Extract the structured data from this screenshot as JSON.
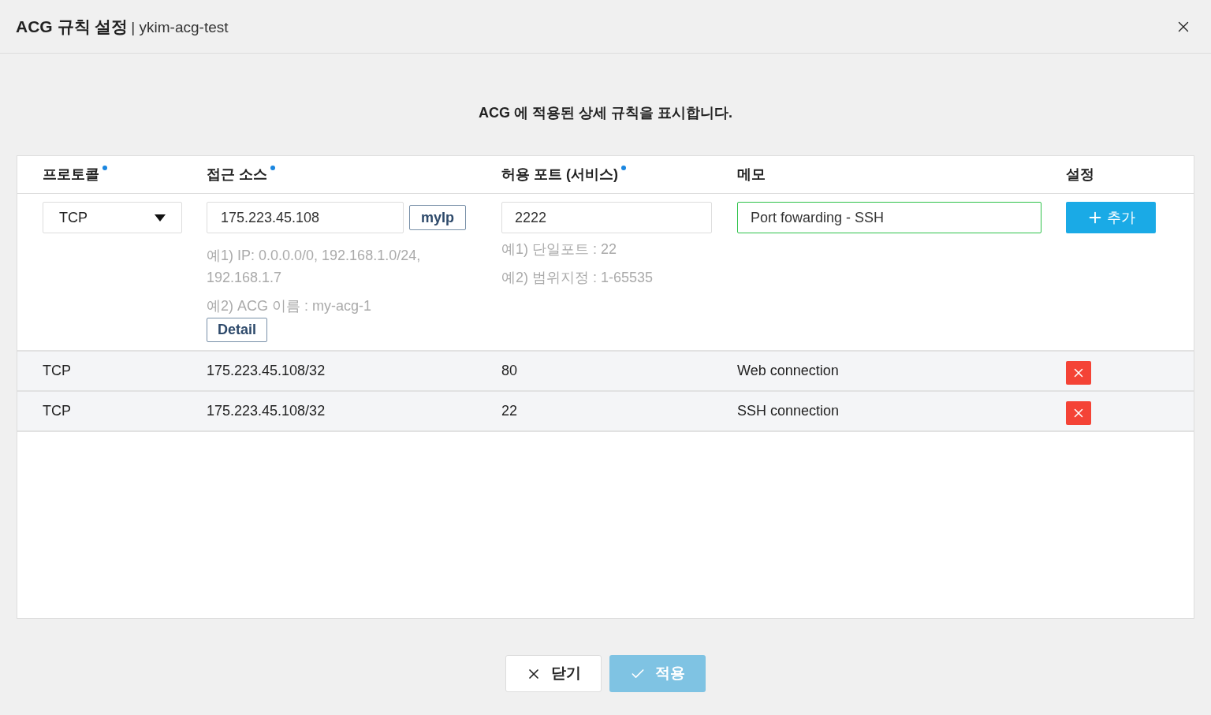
{
  "dialog": {
    "title": "ACG 규칙 설정",
    "separator": "|",
    "subtitle": "ykim-acg-test"
  },
  "description": "ACG 에 적용된 상세 규칙을 표시합니다.",
  "table": {
    "columns": [
      {
        "label": "프로토콜",
        "required": true
      },
      {
        "label": "접근 소스",
        "required": true
      },
      {
        "label": "허용 포트 (서비스)",
        "required": true
      },
      {
        "label": "메모",
        "required": false
      },
      {
        "label": "설정",
        "required": false
      }
    ],
    "form": {
      "protocol": "TCP",
      "source": "175.223.45.108",
      "myip_button": "myIp",
      "source_hints": [
        "예1) IP: 0.0.0.0/0, 192.168.1.0/24, 192.168.1.7",
        "예2) ACG 이름 : my-acg-1"
      ],
      "detail_button": "Detail",
      "port": "2222",
      "port_hints": [
        "예1) 단일포트 : 22",
        "예2) 범위지정 : 1-65535"
      ],
      "memo": "Port fowarding - SSH",
      "memo_focused": true,
      "add_button": "추가"
    },
    "rows": [
      {
        "protocol": "TCP",
        "source": "175.223.45.108/32",
        "port": "80",
        "memo": "Web connection"
      },
      {
        "protocol": "TCP",
        "source": "175.223.45.108/32",
        "port": "22",
        "memo": "SSH connection"
      }
    ]
  },
  "footer": {
    "close_button": {
      "label": "닫기",
      "disabled": false
    },
    "apply_button": {
      "label": "적용",
      "disabled": true
    }
  }
}
